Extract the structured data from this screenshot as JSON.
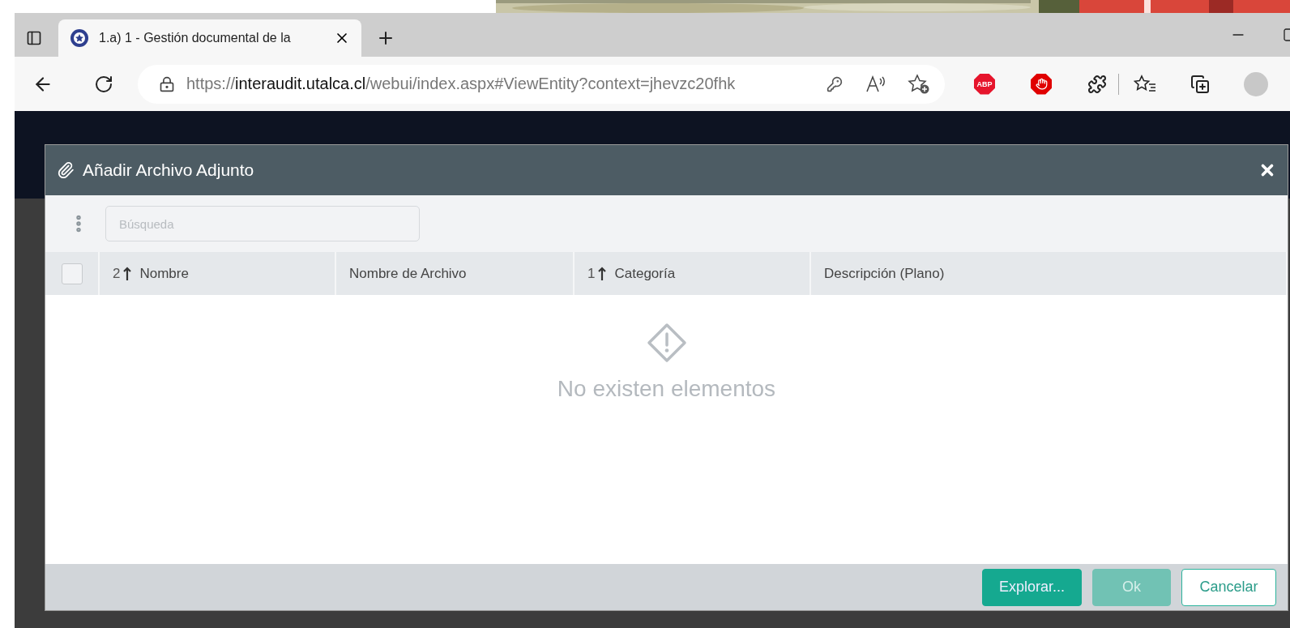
{
  "browser": {
    "tab": {
      "title": "1.a) 1 - Gestión documental de la",
      "selected": true
    },
    "url": {
      "scheme": "https://",
      "host": "interaudit.utalca.cl",
      "path": "/webui/index.aspx#ViewEntity?context=jhevzc20fhk"
    },
    "extension_badge": "ABP"
  },
  "dialog": {
    "title": "Añadir Archivo Adjunto",
    "search": {
      "placeholder": "Búsqueda"
    },
    "select_all": {
      "checked": false
    },
    "columns": [
      {
        "label": "Nombre",
        "sort_rank": "2",
        "sorted": true
      },
      {
        "label": "Nombre de Archivo",
        "sorted": false
      },
      {
        "label": "Categoría",
        "sort_rank": "1",
        "sorted": true
      },
      {
        "label": "Descripción (Plano)",
        "sorted": false
      }
    ],
    "empty_message": "No existen elementos",
    "buttons": [
      {
        "label": "Explorar...",
        "kind": "primary",
        "disabled": false
      },
      {
        "label": "Ok",
        "kind": "primary",
        "disabled": true
      },
      {
        "label": "Cancelar",
        "kind": "outline",
        "disabled": false
      }
    ]
  }
}
